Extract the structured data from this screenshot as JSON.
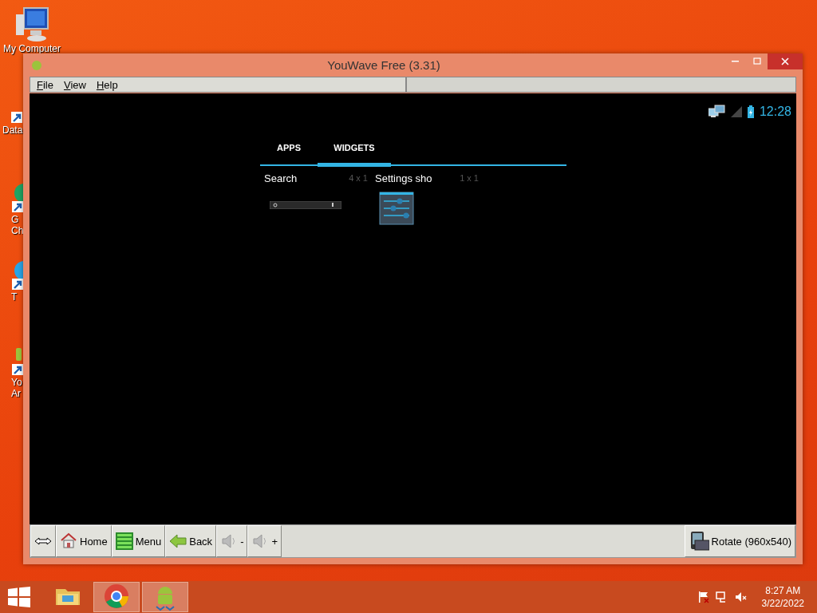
{
  "desktop": {
    "icons": [
      {
        "kind": "computer",
        "lines": [
          "My Computer"
        ]
      },
      {
        "kind": "shortcut",
        "lines": [
          "Data"
        ]
      },
      {
        "kind": "chrome",
        "lines": [
          "G",
          "Ch"
        ]
      },
      {
        "kind": "bird",
        "lines": [
          "T"
        ]
      },
      {
        "kind": "android",
        "lines": [
          "Yo",
          "Ar"
        ]
      }
    ]
  },
  "window": {
    "title": "YouWave Free (3.31)",
    "menu": [
      "File",
      "View",
      "Help"
    ],
    "android": {
      "status": {
        "time": "12:28"
      },
      "tabs": [
        {
          "label": "APPS",
          "selected": false
        },
        {
          "label": "WIDGETS",
          "selected": true
        }
      ],
      "widgets": [
        {
          "kind": "search",
          "name": "Search",
          "size": "4 x 1"
        },
        {
          "kind": "settings",
          "name": "Settings sho",
          "size": "1 x 1"
        }
      ]
    },
    "toolbar": [
      {
        "kind": "resize"
      },
      {
        "kind": "home",
        "label": "Home"
      },
      {
        "kind": "menu",
        "label": "Menu"
      },
      {
        "kind": "back",
        "label": "Back"
      },
      {
        "kind": "vol",
        "label": "-"
      },
      {
        "kind": "vol",
        "label": "+"
      },
      {
        "kind": "rotate",
        "label": "Rotate (960x540)"
      }
    ]
  },
  "taskbar": {
    "apps": [
      {
        "kind": "folder",
        "running": false
      },
      {
        "kind": "chrome",
        "running": true
      },
      {
        "kind": "android",
        "running": true
      }
    ],
    "time": "8:27 AM",
    "date": "3/22/2022"
  }
}
